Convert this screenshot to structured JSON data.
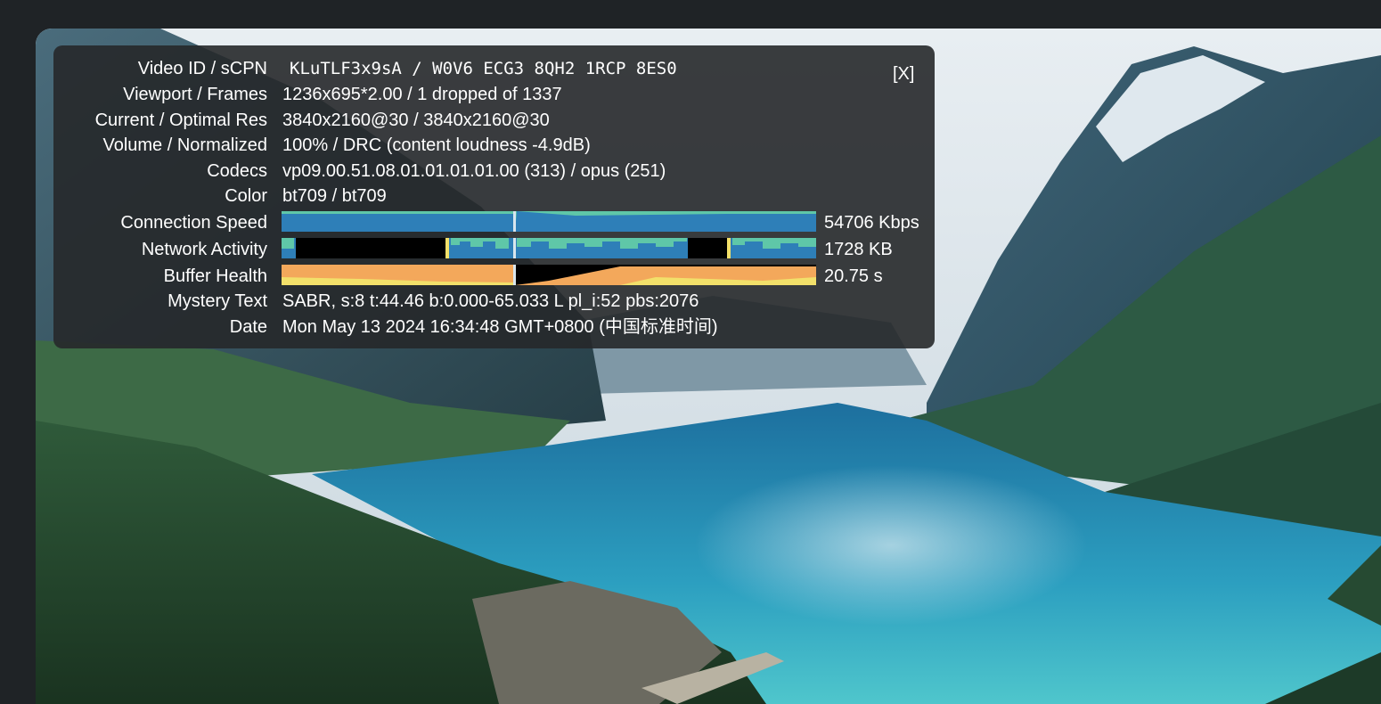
{
  "stats": {
    "close_label": "[X]",
    "rows": [
      {
        "label": "Video ID / sCPN",
        "value": "KLuTLF3x9sA / W0V6 ECG3 8QH2 1RCP 8ES0"
      },
      {
        "label": "Viewport / Frames",
        "value": "1236x695*2.00 / 1 dropped of 1337"
      },
      {
        "label": "Current / Optimal Res",
        "value": "3840x2160@30 / 3840x2160@30"
      },
      {
        "label": "Volume / Normalized",
        "value": "100% / DRC (content loudness -4.9dB)"
      },
      {
        "label": "Codecs",
        "value": "vp09.00.51.08.01.01.01.01.00 (313) / opus (251)"
      },
      {
        "label": "Color",
        "value": "bt709 / bt709"
      },
      {
        "label": "Connection Speed",
        "value": "54706 Kbps"
      },
      {
        "label": "Network Activity",
        "value": "1728 KB"
      },
      {
        "label": "Buffer Health",
        "value": "20.75 s"
      },
      {
        "label": "Mystery Text",
        "value": "SABR, s:8 t:44.46 b:0.000-65.033 L pl_i:52 pbs:2076"
      },
      {
        "label": "Date",
        "value": "Mon May 13 2024 16:34:48 GMT+0800 (中国标准时间)"
      }
    ]
  },
  "colors": {
    "connection_fill": "#2e7fb8",
    "connection_trace": "#5fc7a8",
    "network_fill": "#2e7fb8",
    "network_bar": "#5fc7a8",
    "buffer_fill": "#f3a85b",
    "buffer_light": "#f2e06a",
    "graph_empty": "#000000"
  }
}
